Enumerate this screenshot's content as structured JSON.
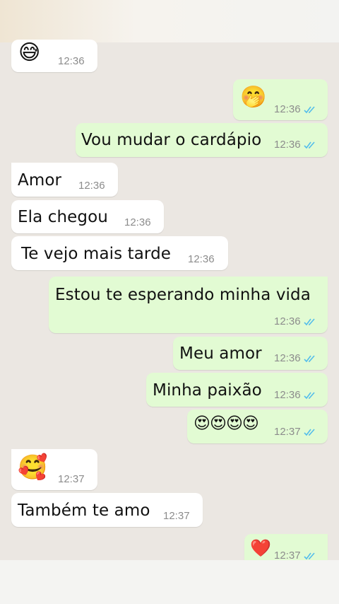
{
  "colors": {
    "incoming_bubble": "#ffffff",
    "outgoing_bubble": "#e2fbd3",
    "read_tick": "#53bdeb",
    "time_text": "#8c8c8c"
  },
  "messages": [
    {
      "direction": "in",
      "emoji": "😅",
      "time": "12:36"
    },
    {
      "direction": "out",
      "emoji": "🤭",
      "time": "12:36",
      "status": "read-double-check-icon"
    },
    {
      "direction": "out",
      "text": "Vou mudar o cardápio",
      "time": "12:36",
      "status": "read-double-check-icon"
    },
    {
      "direction": "in",
      "text": "Amor",
      "time": "12:36"
    },
    {
      "direction": "in",
      "text": "Ela chegou",
      "time": "12:36"
    },
    {
      "direction": "in",
      "text": "Te vejo mais tarde",
      "time": "12:36"
    },
    {
      "direction": "out",
      "text": "Estou te esperando minha vida",
      "time": "12:36",
      "status": "read-double-check-icon"
    },
    {
      "direction": "out",
      "text": "Meu amor",
      "time": "12:36",
      "status": "read-double-check-icon"
    },
    {
      "direction": "out",
      "text": "Minha paixão",
      "time": "12:36",
      "status": "read-double-check-icon"
    },
    {
      "direction": "out",
      "emoji": "😍😍😍😍",
      "time": "12:37",
      "status": "read-double-check-icon"
    },
    {
      "direction": "in",
      "emoji": "🥰",
      "time": "12:37"
    },
    {
      "direction": "in",
      "text": "Também te amo",
      "time": "12:37"
    },
    {
      "direction": "out",
      "emoji": "❤️",
      "time": "12:37",
      "status": "read-double-check-icon"
    }
  ]
}
